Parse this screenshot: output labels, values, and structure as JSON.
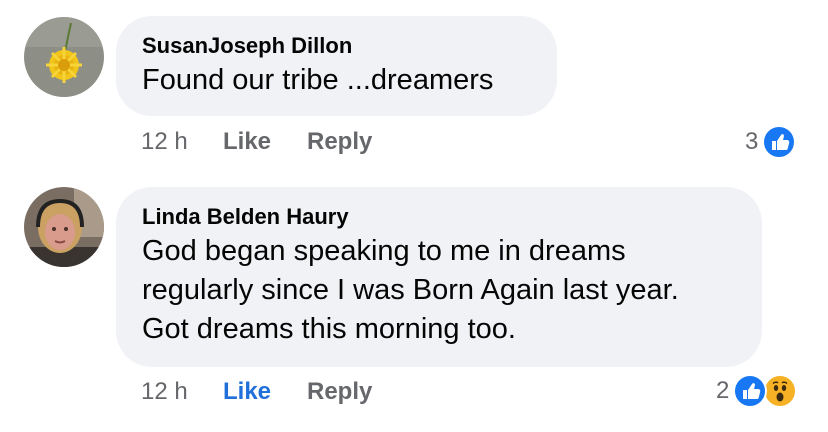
{
  "comments": [
    {
      "author": "SusanJoseph Dillon",
      "text": "Found our tribe ...dreamers",
      "time": "12 h",
      "like_label": "Like",
      "reply_label": "Reply",
      "reaction_count": "3",
      "reactions": [
        "like-icon"
      ],
      "avatar": "dandelion-avatar"
    },
    {
      "author": "Linda Belden Haury",
      "text_lines": [
        "God began speaking to me in dreams",
        "regularly since I was Born Again last year.",
        "Got dreams this morning too."
      ],
      "time": "12 h",
      "like_label": "Like",
      "reply_label": "Reply",
      "like_active": true,
      "reaction_count": "2",
      "reactions": [
        "like-icon",
        "wow-icon"
      ],
      "avatar": "woman-with-headphones-avatar"
    }
  ],
  "colors": {
    "bubble": "#f0f2f5",
    "meta_text": "#65676b",
    "like_active": "#216fdb",
    "reaction_like": "#1877f2",
    "reaction_wow": "#f7b125"
  }
}
